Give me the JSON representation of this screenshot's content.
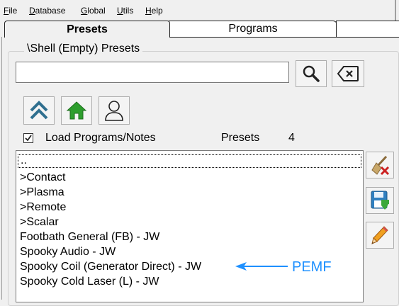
{
  "menu": [
    {
      "label": "File",
      "hotkey": "F",
      "rest": "ile"
    },
    {
      "label": "Database",
      "hotkey": "D",
      "rest": "atabase"
    },
    {
      "label": "Global",
      "hotkey": "G",
      "rest": "lobal"
    },
    {
      "label": "Utils",
      "hotkey": "U",
      "rest": "tils"
    },
    {
      "label": "Help",
      "hotkey": "H",
      "rest": "elp"
    }
  ],
  "tabs": {
    "presets": "Presets",
    "programs": "Programs"
  },
  "group": {
    "title": "\\Shell (Empty) Presets"
  },
  "search": {
    "value": "",
    "placeholder": ""
  },
  "options": {
    "load_programs_label": "Load Programs/Notes",
    "load_programs_checked": true,
    "presets_label": "Presets",
    "presets_count": "4"
  },
  "list": {
    "items": [
      "..",
      ">Contact",
      ">Plasma",
      ">Remote",
      ">Scalar",
      "Footbath General (FB) - JW",
      "Spooky Audio - JW",
      "Spooky Coil (Generator Direct) - JW",
      "Spooky Cold Laser (L) - JW"
    ]
  },
  "icons": {
    "search": "magnifier-icon",
    "clear": "backspace-icon",
    "up": "double-chevron-up-icon",
    "home": "home-icon",
    "user": "user-icon",
    "delete": "broom-delete-icon",
    "save": "save-icon",
    "edit": "pencil-icon"
  },
  "annotation": {
    "text": "PEMF",
    "color": "#1e90ff"
  }
}
